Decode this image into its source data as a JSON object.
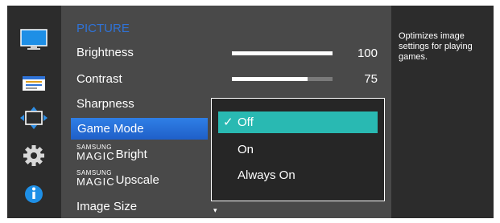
{
  "menu": {
    "title": "PICTURE",
    "items": [
      {
        "label": "Brightness",
        "value": "100",
        "level": 100
      },
      {
        "label": "Contrast",
        "value": "75",
        "level": 75
      },
      {
        "label": "Sharpness"
      },
      {
        "label": "Game Mode"
      },
      {
        "brand_top": "SAMSUNG",
        "brand_bottom": "MAGIC",
        "label": "Bright"
      },
      {
        "brand_top": "SAMSUNG",
        "brand_bottom": "MAGIC",
        "label": "Upscale"
      },
      {
        "label": "Image Size"
      }
    ],
    "scroll_indicator": "▾"
  },
  "dropdown": {
    "options": [
      "Off",
      "On",
      "Always On"
    ],
    "selected_check": "✓"
  },
  "help": {
    "text": "Optimizes image settings for playing games."
  },
  "rail_icons": [
    "monitor-icon",
    "picture-adjust-icon",
    "screen-position-icon",
    "settings-gear-icon",
    "info-icon"
  ],
  "colors": {
    "accent_blue": "#2f7fe6",
    "title_blue": "#2f73d8",
    "selection_teal": "#29b9b2",
    "panel_bg": "#494949"
  }
}
